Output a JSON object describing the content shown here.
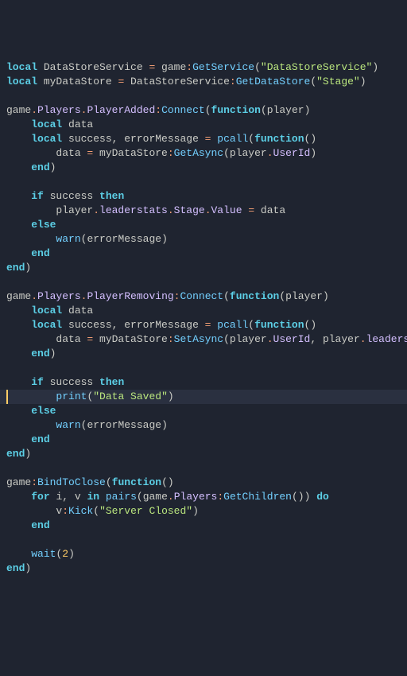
{
  "code": {
    "lines": [
      [
        {
          "t": "local ",
          "c": "kw"
        },
        {
          "t": "DataStoreService ",
          "c": "id"
        },
        {
          "t": "= ",
          "c": "op"
        },
        {
          "t": "game",
          "c": "id"
        },
        {
          "t": ":",
          "c": "dot"
        },
        {
          "t": "GetService",
          "c": "fn"
        },
        {
          "t": "(",
          "c": "paren"
        },
        {
          "t": "\"DataStoreService\"",
          "c": "str"
        },
        {
          "t": ")",
          "c": "paren"
        }
      ],
      [
        {
          "t": "local ",
          "c": "kw"
        },
        {
          "t": "myDataStore ",
          "c": "id"
        },
        {
          "t": "= ",
          "c": "op"
        },
        {
          "t": "DataStoreService",
          "c": "id"
        },
        {
          "t": ":",
          "c": "dot"
        },
        {
          "t": "GetDataStore",
          "c": "fn"
        },
        {
          "t": "(",
          "c": "paren"
        },
        {
          "t": "\"Stage\"",
          "c": "str"
        },
        {
          "t": ")",
          "c": "paren"
        }
      ],
      [],
      [
        {
          "t": "game",
          "c": "id"
        },
        {
          "t": ".",
          "c": "dot"
        },
        {
          "t": "Players",
          "c": "prop"
        },
        {
          "t": ".",
          "c": "dot"
        },
        {
          "t": "PlayerAdded",
          "c": "prop"
        },
        {
          "t": ":",
          "c": "dot"
        },
        {
          "t": "Connect",
          "c": "fn"
        },
        {
          "t": "(",
          "c": "paren"
        },
        {
          "t": "function",
          "c": "kw"
        },
        {
          "t": "(",
          "c": "paren"
        },
        {
          "t": "player",
          "c": "id"
        },
        {
          "t": ")",
          "c": "paren"
        }
      ],
      [
        {
          "t": "    ",
          "c": "id"
        },
        {
          "t": "local ",
          "c": "kw"
        },
        {
          "t": "data",
          "c": "id"
        }
      ],
      [
        {
          "t": "    ",
          "c": "id"
        },
        {
          "t": "local ",
          "c": "kw"
        },
        {
          "t": "success",
          "c": "id"
        },
        {
          "t": ", ",
          "c": "paren"
        },
        {
          "t": "errorMessage ",
          "c": "id"
        },
        {
          "t": "= ",
          "c": "op"
        },
        {
          "t": "pcall",
          "c": "fn"
        },
        {
          "t": "(",
          "c": "paren"
        },
        {
          "t": "function",
          "c": "kw"
        },
        {
          "t": "()",
          "c": "paren"
        }
      ],
      [
        {
          "t": "        data ",
          "c": "id"
        },
        {
          "t": "= ",
          "c": "op"
        },
        {
          "t": "myDataStore",
          "c": "id"
        },
        {
          "t": ":",
          "c": "dot"
        },
        {
          "t": "GetAsync",
          "c": "fn"
        },
        {
          "t": "(",
          "c": "paren"
        },
        {
          "t": "player",
          "c": "id"
        },
        {
          "t": ".",
          "c": "dot"
        },
        {
          "t": "UserId",
          "c": "prop"
        },
        {
          "t": ")",
          "c": "paren"
        }
      ],
      [
        {
          "t": "    ",
          "c": "id"
        },
        {
          "t": "end",
          "c": "kw"
        },
        {
          "t": ")",
          "c": "paren"
        }
      ],
      [],
      [
        {
          "t": "    ",
          "c": "id"
        },
        {
          "t": "if ",
          "c": "kw"
        },
        {
          "t": "success ",
          "c": "id"
        },
        {
          "t": "then",
          "c": "kw"
        }
      ],
      [
        {
          "t": "        player",
          "c": "id"
        },
        {
          "t": ".",
          "c": "dot"
        },
        {
          "t": "leaderstats",
          "c": "prop"
        },
        {
          "t": ".",
          "c": "dot"
        },
        {
          "t": "Stage",
          "c": "prop"
        },
        {
          "t": ".",
          "c": "dot"
        },
        {
          "t": "Value ",
          "c": "prop"
        },
        {
          "t": "= ",
          "c": "op"
        },
        {
          "t": "data",
          "c": "id"
        }
      ],
      [
        {
          "t": "    ",
          "c": "id"
        },
        {
          "t": "else",
          "c": "kw"
        }
      ],
      [
        {
          "t": "        ",
          "c": "id"
        },
        {
          "t": "warn",
          "c": "fn"
        },
        {
          "t": "(",
          "c": "paren"
        },
        {
          "t": "errorMessage",
          "c": "id"
        },
        {
          "t": ")",
          "c": "paren"
        }
      ],
      [
        {
          "t": "    ",
          "c": "id"
        },
        {
          "t": "end",
          "c": "kw"
        }
      ],
      [
        {
          "t": "end",
          "c": "kw"
        },
        {
          "t": ")",
          "c": "paren"
        }
      ],
      [],
      [
        {
          "t": "game",
          "c": "id"
        },
        {
          "t": ".",
          "c": "dot"
        },
        {
          "t": "Players",
          "c": "prop"
        },
        {
          "t": ".",
          "c": "dot"
        },
        {
          "t": "PlayerRemoving",
          "c": "prop"
        },
        {
          "t": ":",
          "c": "dot"
        },
        {
          "t": "Connect",
          "c": "fn"
        },
        {
          "t": "(",
          "c": "paren"
        },
        {
          "t": "function",
          "c": "kw"
        },
        {
          "t": "(",
          "c": "paren"
        },
        {
          "t": "player",
          "c": "id"
        },
        {
          "t": ")",
          "c": "paren"
        }
      ],
      [
        {
          "t": "    ",
          "c": "id"
        },
        {
          "t": "local ",
          "c": "kw"
        },
        {
          "t": "data",
          "c": "id"
        }
      ],
      [
        {
          "t": "    ",
          "c": "id"
        },
        {
          "t": "local ",
          "c": "kw"
        },
        {
          "t": "success",
          "c": "id"
        },
        {
          "t": ", ",
          "c": "paren"
        },
        {
          "t": "errorMessage ",
          "c": "id"
        },
        {
          "t": "= ",
          "c": "op"
        },
        {
          "t": "pcall",
          "c": "fn"
        },
        {
          "t": "(",
          "c": "paren"
        },
        {
          "t": "function",
          "c": "kw"
        },
        {
          "t": "()",
          "c": "paren"
        }
      ],
      [
        {
          "t": "        data ",
          "c": "id"
        },
        {
          "t": "= ",
          "c": "op"
        },
        {
          "t": "myDataStore",
          "c": "id"
        },
        {
          "t": ":",
          "c": "dot"
        },
        {
          "t": "SetAsync",
          "c": "fn"
        },
        {
          "t": "(",
          "c": "paren"
        },
        {
          "t": "player",
          "c": "id"
        },
        {
          "t": ".",
          "c": "dot"
        },
        {
          "t": "UserId",
          "c": "prop"
        },
        {
          "t": ", ",
          "c": "paren"
        },
        {
          "t": "player",
          "c": "id"
        },
        {
          "t": ".",
          "c": "dot"
        },
        {
          "t": "leaderstats",
          "c": "prop"
        },
        {
          "t": ".",
          "c": "dot"
        }
      ],
      [
        {
          "t": "    ",
          "c": "id"
        },
        {
          "t": "end",
          "c": "kw"
        },
        {
          "t": ")",
          "c": "paren"
        }
      ],
      [],
      [
        {
          "t": "    ",
          "c": "id"
        },
        {
          "t": "if ",
          "c": "kw"
        },
        {
          "t": "success ",
          "c": "id"
        },
        {
          "t": "then",
          "c": "kw"
        }
      ],
      [
        {
          "t": "        ",
          "c": "id"
        },
        {
          "t": "print",
          "c": "fn"
        },
        {
          "t": "(",
          "c": "paren"
        },
        {
          "t": "\"Data Saved\"",
          "c": "str"
        },
        {
          "t": ")",
          "c": "paren"
        }
      ],
      [
        {
          "t": "    ",
          "c": "id"
        },
        {
          "t": "else",
          "c": "kw"
        }
      ],
      [
        {
          "t": "        ",
          "c": "id"
        },
        {
          "t": "warn",
          "c": "fn"
        },
        {
          "t": "(",
          "c": "paren"
        },
        {
          "t": "errorMessage",
          "c": "id"
        },
        {
          "t": ")",
          "c": "paren"
        }
      ],
      [
        {
          "t": "    ",
          "c": "id"
        },
        {
          "t": "end",
          "c": "kw"
        }
      ],
      [
        {
          "t": "end",
          "c": "kw"
        },
        {
          "t": ")",
          "c": "paren"
        }
      ],
      [],
      [
        {
          "t": "game",
          "c": "id"
        },
        {
          "t": ":",
          "c": "dot"
        },
        {
          "t": "BindToClose",
          "c": "fn"
        },
        {
          "t": "(",
          "c": "paren"
        },
        {
          "t": "function",
          "c": "kw"
        },
        {
          "t": "()",
          "c": "paren"
        }
      ],
      [
        {
          "t": "    ",
          "c": "id"
        },
        {
          "t": "for ",
          "c": "kw"
        },
        {
          "t": "i",
          "c": "id"
        },
        {
          "t": ", ",
          "c": "paren"
        },
        {
          "t": "v ",
          "c": "id"
        },
        {
          "t": "in ",
          "c": "kw"
        },
        {
          "t": "pairs",
          "c": "fn"
        },
        {
          "t": "(",
          "c": "paren"
        },
        {
          "t": "game",
          "c": "id"
        },
        {
          "t": ".",
          "c": "dot"
        },
        {
          "t": "Players",
          "c": "prop"
        },
        {
          "t": ":",
          "c": "dot"
        },
        {
          "t": "GetChildren",
          "c": "fn"
        },
        {
          "t": "()) ",
          "c": "paren"
        },
        {
          "t": "do",
          "c": "kw"
        }
      ],
      [
        {
          "t": "        v",
          "c": "id"
        },
        {
          "t": ":",
          "c": "dot"
        },
        {
          "t": "Kick",
          "c": "fn"
        },
        {
          "t": "(",
          "c": "paren"
        },
        {
          "t": "\"Server Closed\"",
          "c": "str"
        },
        {
          "t": ")",
          "c": "paren"
        }
      ],
      [
        {
          "t": "    ",
          "c": "id"
        },
        {
          "t": "end",
          "c": "kw"
        }
      ],
      [],
      [
        {
          "t": "    ",
          "c": "id"
        },
        {
          "t": "wait",
          "c": "fn"
        },
        {
          "t": "(",
          "c": "paren"
        },
        {
          "t": "2",
          "c": "num"
        },
        {
          "t": ")",
          "c": "paren"
        }
      ],
      [
        {
          "t": "end",
          "c": "kw"
        },
        {
          "t": ")",
          "c": "paren"
        }
      ]
    ]
  }
}
